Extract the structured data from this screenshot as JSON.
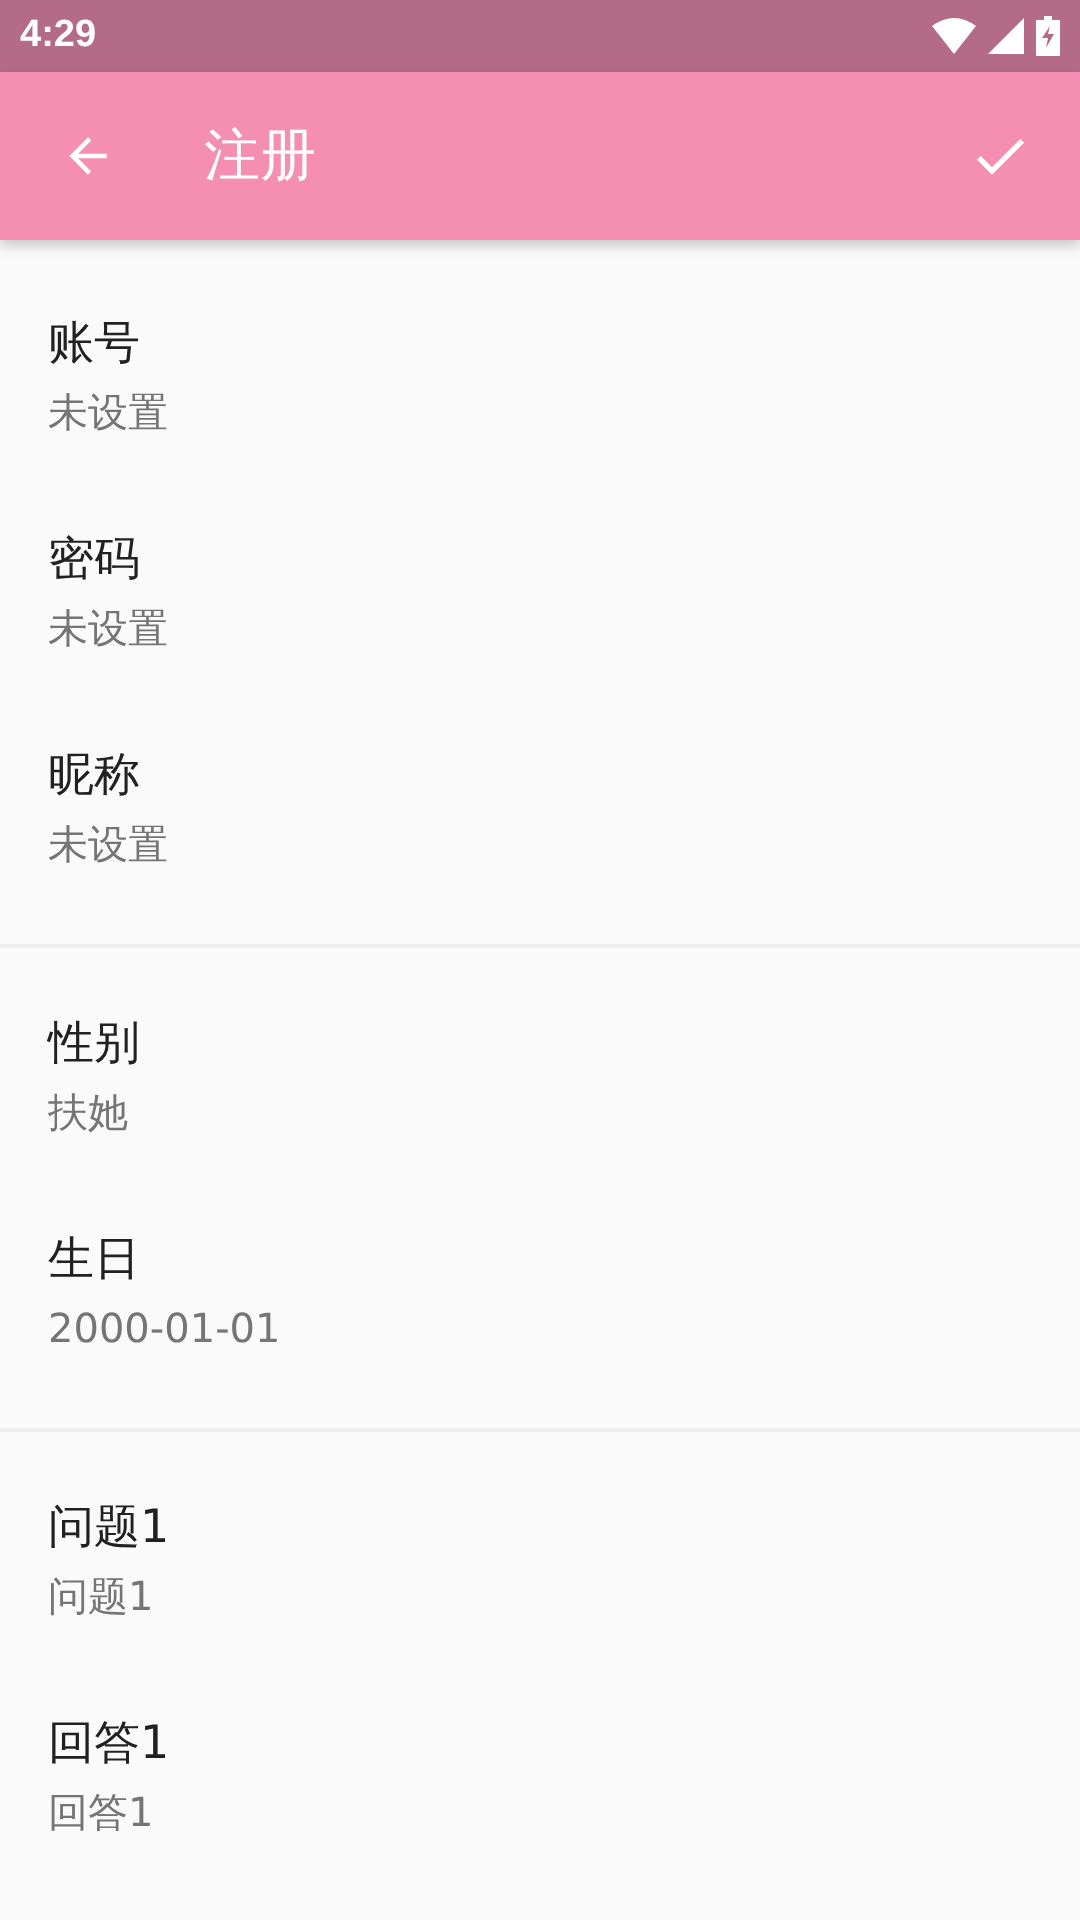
{
  "status_bar": {
    "time": "4:29"
  },
  "app_bar": {
    "title": "注册"
  },
  "sections": [
    {
      "items": [
        {
          "label": "账号",
          "value": "未设置"
        },
        {
          "label": "密码",
          "value": "未设置"
        },
        {
          "label": "昵称",
          "value": "未设置"
        }
      ]
    },
    {
      "items": [
        {
          "label": "性别",
          "value": "扶她"
        },
        {
          "label": "生日",
          "value": "2000-01-01"
        }
      ]
    },
    {
      "items": [
        {
          "label": "问题1",
          "value": "问题1"
        },
        {
          "label": "回答1",
          "value": "回答1"
        }
      ]
    }
  ]
}
